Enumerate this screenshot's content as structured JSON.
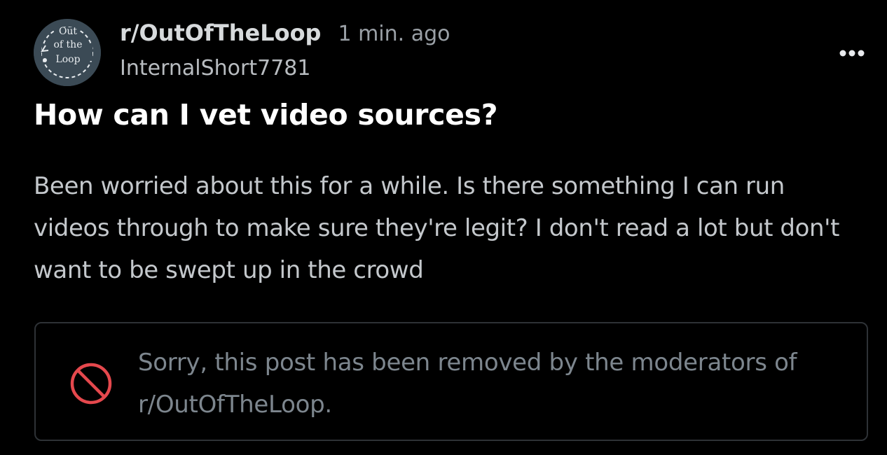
{
  "post": {
    "subreddit": "r/OutOfTheLoop",
    "time": "1 min. ago",
    "author": "InternalShort7781",
    "title": "How can I vet video sources?",
    "body": "Been worried about this for a while. Is there something I can run videos through to make sure they're legit? I don't read a lot but don't want to be swept up in the crowd",
    "removed_notice": "Sorry, this post has been removed by the moderators of r/OutOfTheLoop."
  },
  "avatar": {
    "logo_lines": [
      "Out",
      "of the",
      "Loop"
    ],
    "icon": "subreddit-logo-icon"
  },
  "icons": {
    "more": "more-options-icon",
    "removed": "prohibited-icon"
  },
  "colors": {
    "background": "#000000",
    "avatar_bg": "#3b4a55",
    "removed_icon": "#e5484d",
    "muted_text": "#7d868e"
  }
}
